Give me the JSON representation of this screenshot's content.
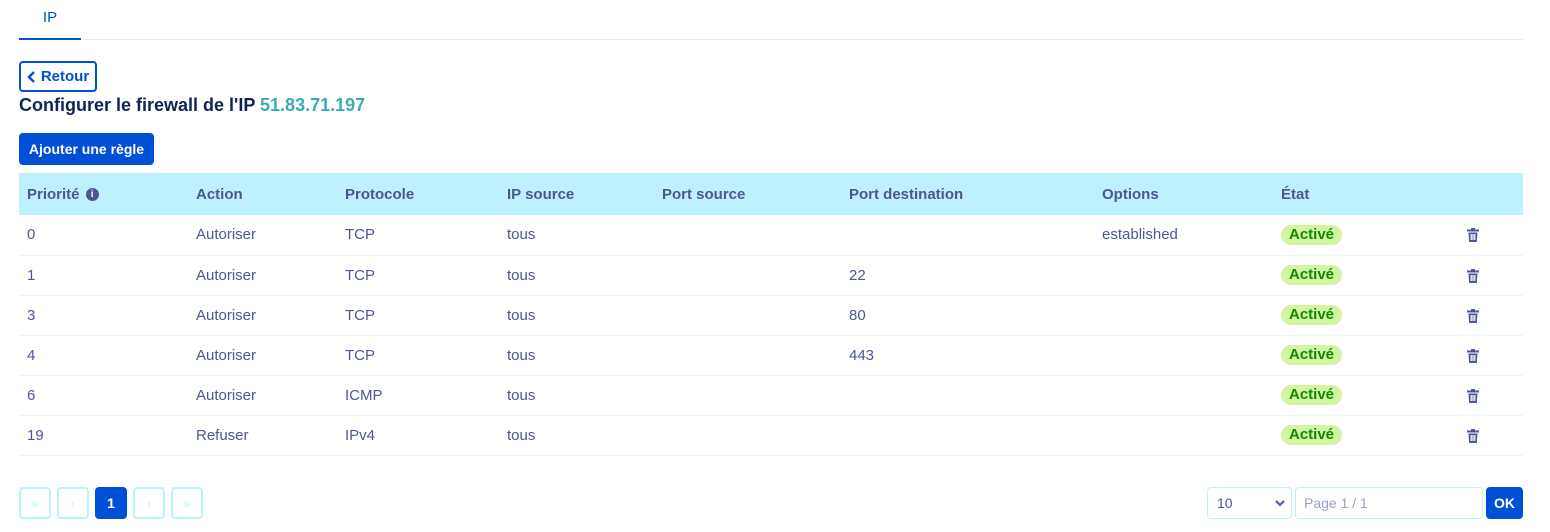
{
  "tabs": [
    {
      "label": "IP"
    }
  ],
  "back_button": {
    "label": "Retour"
  },
  "title": {
    "text": "Configurer le firewall de l'IP",
    "ip": "51.83.71.197"
  },
  "add_button": {
    "label": "Ajouter une règle"
  },
  "table": {
    "headers": [
      "Priorité",
      "Action",
      "Protocole",
      "IP source",
      "Port source",
      "Port destination",
      "Options",
      "État"
    ],
    "rows": [
      {
        "priority": "0",
        "action": "Autoriser",
        "protocol": "TCP",
        "source_ip": "tous",
        "source_port": "",
        "dest_port": "",
        "options": "established",
        "state": "Activé"
      },
      {
        "priority": "1",
        "action": "Autoriser",
        "protocol": "TCP",
        "source_ip": "tous",
        "source_port": "",
        "dest_port": "22",
        "options": "",
        "state": "Activé"
      },
      {
        "priority": "3",
        "action": "Autoriser",
        "protocol": "TCP",
        "source_ip": "tous",
        "source_port": "",
        "dest_port": "80",
        "options": "",
        "state": "Activé"
      },
      {
        "priority": "4",
        "action": "Autoriser",
        "protocol": "TCP",
        "source_ip": "tous",
        "source_port": "",
        "dest_port": "443",
        "options": "",
        "state": "Activé"
      },
      {
        "priority": "6",
        "action": "Autoriser",
        "protocol": "ICMP",
        "source_ip": "tous",
        "source_port": "",
        "dest_port": "",
        "options": "",
        "state": "Activé"
      },
      {
        "priority": "19",
        "action": "Refuser",
        "protocol": "IPv4",
        "source_ip": "tous",
        "source_port": "",
        "dest_port": "",
        "options": "",
        "state": "Activé"
      }
    ]
  },
  "pagination": {
    "first": "«",
    "prev": "‹",
    "current": "1",
    "next": "›",
    "last": "»",
    "page_size": "10",
    "page_placeholder": "Page 1 / 1",
    "ok_label": "OK"
  },
  "colors": {
    "primary": "#0050d7",
    "header_bg": "#bef1ff",
    "badge_bg": "#d2f4a3",
    "badge_text": "#118a00",
    "ip_color": "#3bacb7"
  }
}
